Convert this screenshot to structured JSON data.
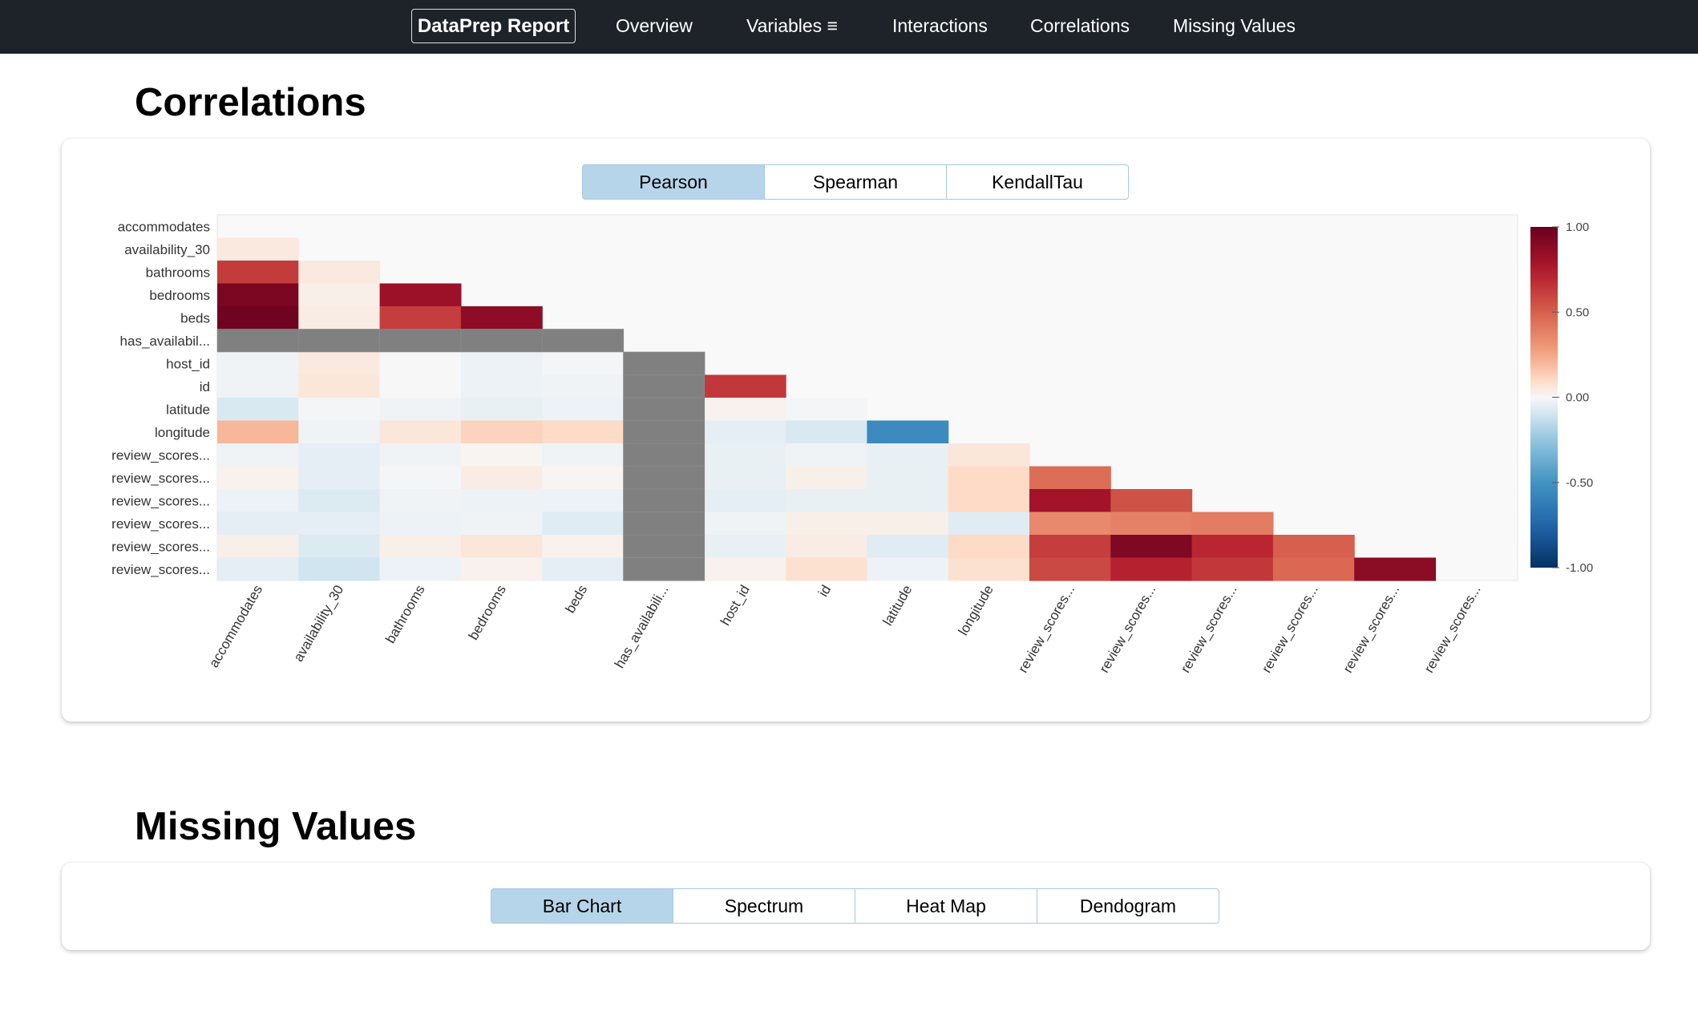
{
  "navbar": {
    "brand": "DataPrep Report",
    "links": [
      "Overview",
      "Variables ≡",
      "Interactions",
      "Correlations",
      "Missing Values"
    ]
  },
  "correlations": {
    "title": "Correlations",
    "tabs": [
      "Pearson",
      "Spearman",
      "KendallTau"
    ],
    "active_tab": "Pearson"
  },
  "missing_values": {
    "title": "Missing Values",
    "tabs": [
      "Bar Chart",
      "Spectrum",
      "Heat Map",
      "Dendogram"
    ],
    "active_tab": "Bar Chart"
  },
  "chart_data": {
    "type": "heatmap",
    "row_labels": [
      "accommodates",
      "availability_30",
      "bathrooms",
      "bedrooms",
      "beds",
      "has_availabil...",
      "host_id",
      "id",
      "latitude",
      "longitude",
      "review_scores...",
      "review_scores...",
      "review_scores...",
      "review_scores...",
      "review_scores...",
      "review_scores..."
    ],
    "col_labels": [
      "accommodates",
      "availability_30",
      "bathrooms",
      "bedrooms",
      "beds",
      "has_availabili...",
      "host_id",
      "id",
      "latitude",
      "longitude",
      "review_scores...",
      "review_scores...",
      "review_scores...",
      "review_scores...",
      "review_scores...",
      "review_scores..."
    ],
    "values": [
      [],
      [
        0.05
      ],
      [
        0.63,
        0.05
      ],
      [
        0.93,
        0.03,
        0.82
      ],
      [
        0.97,
        0.04,
        0.62,
        0.87
      ],
      [
        null,
        null,
        null,
        null,
        null
      ],
      [
        -0.02,
        0.05,
        0.0,
        -0.03,
        -0.01,
        null
      ],
      [
        -0.02,
        0.06,
        0.0,
        -0.03,
        -0.02,
        null,
        0.64
      ],
      [
        -0.08,
        -0.01,
        -0.02,
        -0.04,
        -0.03,
        null,
        0.02,
        -0.01
      ],
      [
        0.2,
        -0.02,
        0.06,
        0.12,
        0.1,
        null,
        -0.05,
        -0.08,
        -0.55
      ],
      [
        -0.02,
        -0.05,
        -0.02,
        0.01,
        -0.02,
        null,
        -0.04,
        -0.02,
        -0.04,
        0.06
      ],
      [
        0.02,
        -0.05,
        -0.01,
        0.04,
        0.01,
        null,
        -0.04,
        0.03,
        -0.04,
        0.1,
        0.45
      ],
      [
        -0.03,
        -0.07,
        -0.02,
        -0.03,
        -0.03,
        null,
        -0.05,
        -0.04,
        -0.04,
        0.1,
        0.8,
        0.55
      ],
      [
        -0.05,
        -0.05,
        -0.03,
        -0.02,
        -0.06,
        null,
        -0.02,
        0.03,
        0.03,
        -0.06,
        0.35,
        0.38,
        0.4
      ],
      [
        0.03,
        -0.07,
        0.03,
        0.06,
        0.02,
        null,
        -0.04,
        0.04,
        -0.06,
        0.1,
        0.62,
        0.92,
        0.7,
        0.5
      ],
      [
        -0.05,
        -0.1,
        -0.03,
        0.02,
        -0.05,
        null,
        0.02,
        0.08,
        -0.03,
        0.08,
        0.58,
        0.72,
        0.64,
        0.47,
        0.88
      ]
    ],
    "colorbar": {
      "min": -1.0,
      "max": 1.0,
      "ticks": [
        "1.00",
        "0.50",
        "0.00",
        "-0.50",
        "-1.00"
      ]
    },
    "colors": {
      "positive": "#67001f",
      "negative": "#053061",
      "neutral": "#f7f7f7",
      "missing": "#808080"
    }
  }
}
